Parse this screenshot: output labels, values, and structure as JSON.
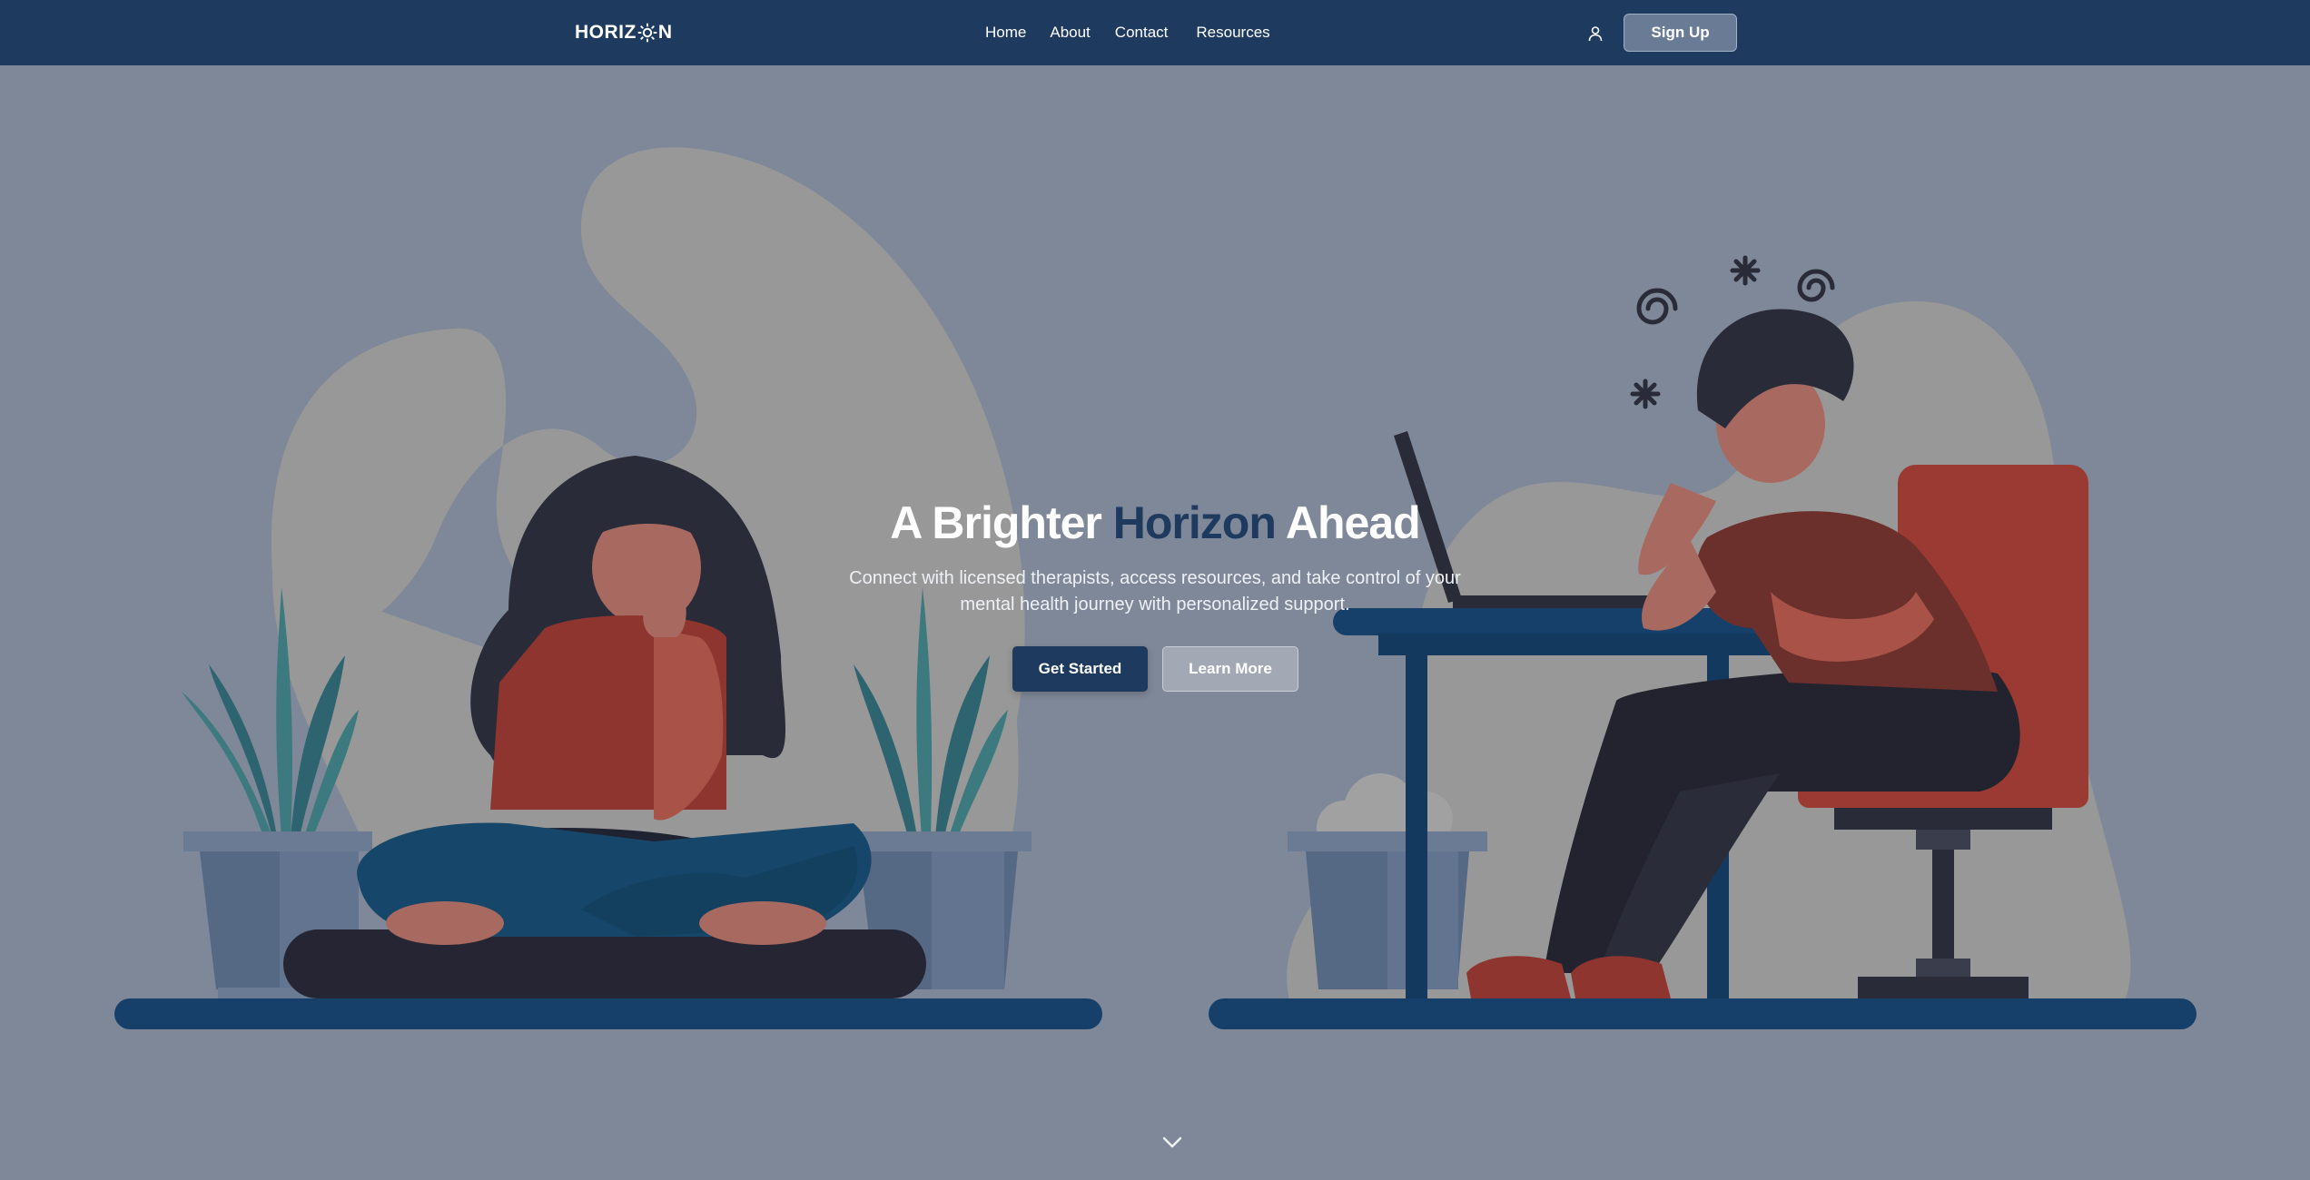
{
  "nav": {
    "logo": {
      "prefix": "HORIZ",
      "suffix": "N",
      "icon": "sun-icon"
    },
    "links": [
      "Home",
      "About",
      "Contact",
      "Resources"
    ],
    "user_icon": "user-icon",
    "signup_label": "Sign Up"
  },
  "hero": {
    "title_start": "A Brighter ",
    "title_accent": "Horizon",
    "title_end": " Ahead",
    "subtitle": "Connect with licensed therapists, access resources, and take control of your mental health journey with personalized support.",
    "primary_label": "Get Started",
    "secondary_label": "Learn More",
    "scroll_icon": "chevron-down-icon"
  },
  "colors": {
    "nav_bg": "#1e3a5f",
    "page_bg": "#7f8898",
    "accent": "#1e3a5f"
  }
}
